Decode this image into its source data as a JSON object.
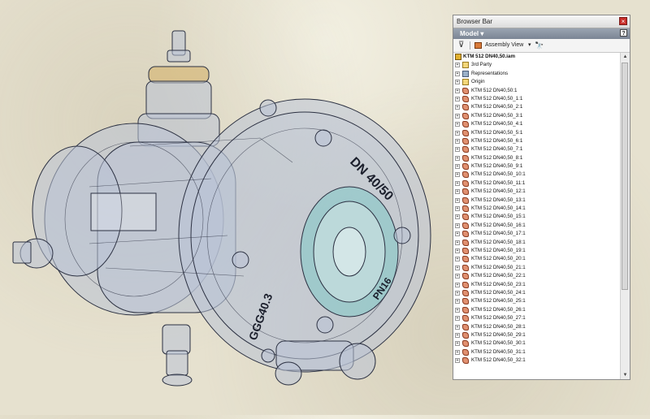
{
  "panel": {
    "title": "Browser Bar",
    "close_label": "×",
    "model_label": "Model ▾",
    "help_label": "?",
    "toolbar": {
      "filter_glyph": "⊽",
      "view_label": "Assembly View",
      "dropdown_glyph": "▾",
      "find_glyph": "🔭"
    }
  },
  "tree": {
    "root": "KTM 512 DN40,50.iam",
    "fixed": [
      {
        "label": "3rd Party",
        "icon": "folder"
      },
      {
        "label": "Representations",
        "icon": "repr"
      },
      {
        "label": "Origin",
        "icon": "folder"
      }
    ],
    "parts": [
      "KTM 512 DN40,50:1",
      "KTM 512 DN40,50_1:1",
      "KTM 512 DN40,50_2:1",
      "KTM 512 DN40,50_3:1",
      "KTM 512 DN40,50_4:1",
      "KTM 512 DN40,50_5:1",
      "KTM 512 DN40,50_6:1",
      "KTM 512 DN40,50_7:1",
      "KTM 512 DN40,50_8:1",
      "KTM 512 DN40,50_9:1",
      "KTM 512 DN40,50_10:1",
      "KTM 512 DN40,50_11:1",
      "KTM 512 DN40,50_12:1",
      "KTM 512 DN40,50_13:1",
      "KTM 512 DN40,50_14:1",
      "KTM 512 DN40,50_15:1",
      "KTM 512 DN40,50_16:1",
      "KTM 512 DN40,50_17:1",
      "KTM 512 DN40,50_18:1",
      "KTM 512 DN40,50_19:1",
      "KTM 512 DN40,50_20:1",
      "KTM 512 DN40,50_21:1",
      "KTM 512 DN40,50_22:1",
      "KTM 512 DN40,50_23:1",
      "KTM 512 DN40,50_24:1",
      "KTM 512 DN40,50_25:1",
      "KTM 512 DN40,50_26:1",
      "KTM 512 DN40,50_27:1",
      "KTM 512 DN40,50_28:1",
      "KTM 512 DN40,50_29:1",
      "KTM 512 DN40,50_30:1",
      "KTM 512 DN40,50_31:1",
      "KTM 512 DN40,50_32:1"
    ]
  },
  "model_text": {
    "dn": "DN 40/50",
    "code": "GGG40.3",
    "pn": "PN16"
  },
  "colors": {
    "body_fill": "#b9c3d6",
    "accent_cyan": "#7fc9c7",
    "ring_tan": "#d6b878",
    "panel_bg": "#f4f4f4"
  }
}
